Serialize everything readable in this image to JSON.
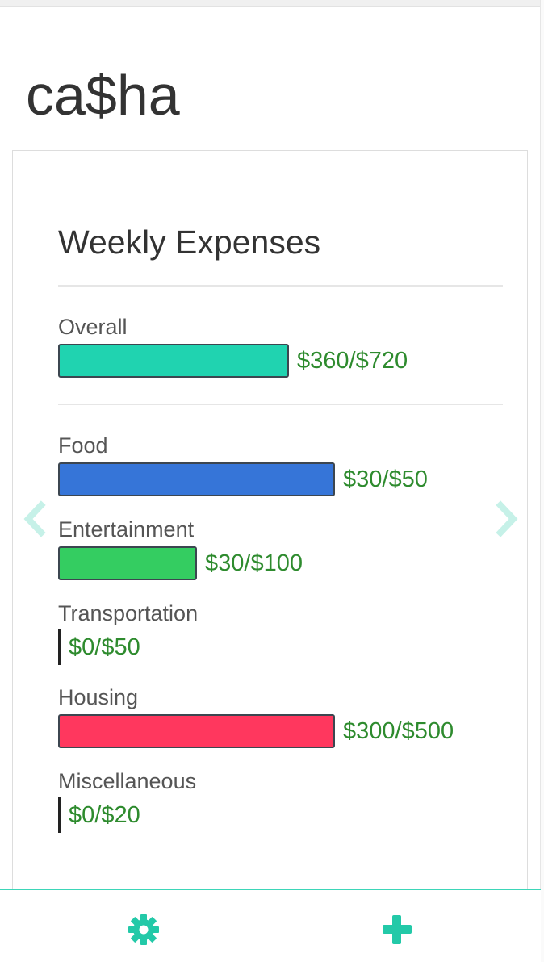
{
  "app": {
    "title": "ca$ha"
  },
  "card": {
    "title": "Weekly Expenses"
  },
  "overall": {
    "label": "Overall",
    "spent": 360,
    "budget": 720,
    "amount_text": "$360/$720",
    "color": "#20d3b0"
  },
  "categories": [
    {
      "label": "Food",
      "spent": 30,
      "budget": 50,
      "amount_text": "$30/$50",
      "color": "#3675d8"
    },
    {
      "label": "Entertainment",
      "spent": 30,
      "budget": 100,
      "amount_text": "$30/$100",
      "color": "#34cd61"
    },
    {
      "label": "Transportation",
      "spent": 0,
      "budget": 50,
      "amount_text": "$0/$50",
      "color": "#222222"
    },
    {
      "label": "Housing",
      "spent": 300,
      "budget": 500,
      "amount_text": "$300/$500",
      "color": "#ff375e"
    },
    {
      "label": "Miscellaneous",
      "spent": 0,
      "budget": 20,
      "amount_text": "$0/$20",
      "color": "#222222"
    }
  ],
  "nav": {
    "prev_icon": "chevron-left-icon",
    "next_icon": "chevron-right-icon",
    "arrow_color": "#c6f1e8"
  },
  "footer": {
    "settings_icon": "gear-icon",
    "add_icon": "plus-icon",
    "accent_color": "#23c9a8"
  }
}
